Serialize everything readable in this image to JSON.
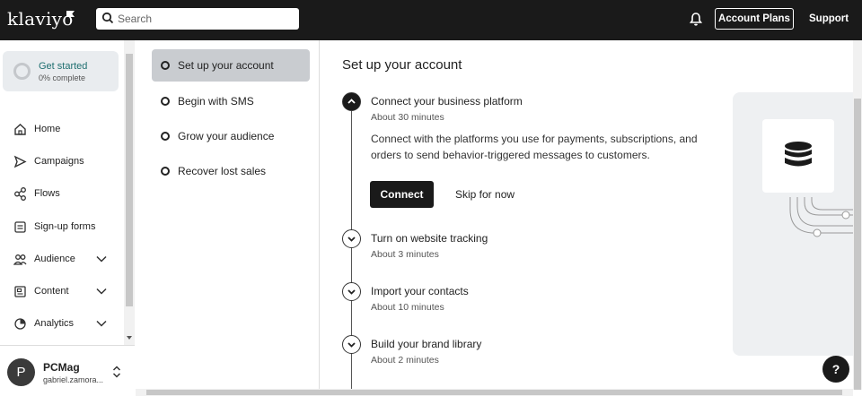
{
  "header": {
    "logo_text": "klaviyo",
    "search": {
      "placeholder": "Search",
      "value": ""
    },
    "account_plans_label": "Account Plans",
    "support_label": "Support",
    "bg_color": "#1a1a1a"
  },
  "sidebar": {
    "get_started": {
      "title": "Get started",
      "progress_text": "0% complete",
      "progress": 0
    },
    "items": [
      {
        "label": "Home",
        "icon": "home-icon",
        "has_chevron": false
      },
      {
        "label": "Campaigns",
        "icon": "send-icon",
        "has_chevron": false
      },
      {
        "label": "Flows",
        "icon": "flows-icon",
        "has_chevron": false
      },
      {
        "label": "Sign-up forms",
        "icon": "form-icon",
        "has_chevron": false
      },
      {
        "label": "Audience",
        "icon": "users-icon",
        "has_chevron": true
      },
      {
        "label": "Content",
        "icon": "content-icon",
        "has_chevron": true
      },
      {
        "label": "Analytics",
        "icon": "pie-chart-icon",
        "has_chevron": true
      }
    ],
    "user": {
      "avatar_letter": "P",
      "name": "PCMag",
      "email": "gabriel.zamora..."
    }
  },
  "steps": [
    {
      "label": "Set up your account",
      "active": true
    },
    {
      "label": "Begin with SMS",
      "active": false
    },
    {
      "label": "Grow your audience",
      "active": false
    },
    {
      "label": "Recover lost sales",
      "active": false
    }
  ],
  "main": {
    "title": "Set up your account",
    "tasks": [
      {
        "title": "Connect your business platform",
        "time": "About 30 minutes",
        "expanded": true,
        "description": "Connect with the platforms you use for payments, subscriptions, and orders to send behavior-triggered messages to customers.",
        "primary_label": "Connect",
        "secondary_label": "Skip for now"
      },
      {
        "title": "Turn on website tracking",
        "time": "About 3 minutes",
        "expanded": false
      },
      {
        "title": "Import your contacts",
        "time": "About 10 minutes",
        "expanded": false
      },
      {
        "title": "Build your brand library",
        "time": "About 2 minutes",
        "expanded": false
      }
    ]
  },
  "help_label": "?"
}
